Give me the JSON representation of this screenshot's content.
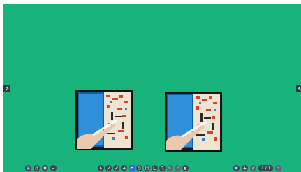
{
  "board": {
    "background": "#18b37a"
  },
  "edge_buttons": {
    "left_icon": "chevron-right-icon",
    "right_icon": "chevron-left-icon"
  },
  "thumbnails": [
    {
      "name": "image-thumbnail-1",
      "description_icon": "image-icon"
    },
    {
      "name": "image-thumbnail-2",
      "description_icon": "image-icon"
    }
  ],
  "left_toolbar": {
    "icons": [
      "menu-icon",
      "settings-icon",
      "save-icon",
      "undo-icon"
    ]
  },
  "center_toolbar": {
    "icons": [
      "select-icon",
      "pen-icon",
      "highlighter-icon",
      "eraser-icon",
      "shape-icon",
      "text-icon",
      "image-icon",
      "crop-icon",
      "zoom-icon",
      "undo-icon",
      "redo-icon",
      "delete-icon"
    ],
    "active_index": 4
  },
  "page_nav": {
    "icons": [
      "add-page-icon",
      "prev-page-icon",
      "next-page-icon"
    ],
    "counter": "1 / 1"
  }
}
